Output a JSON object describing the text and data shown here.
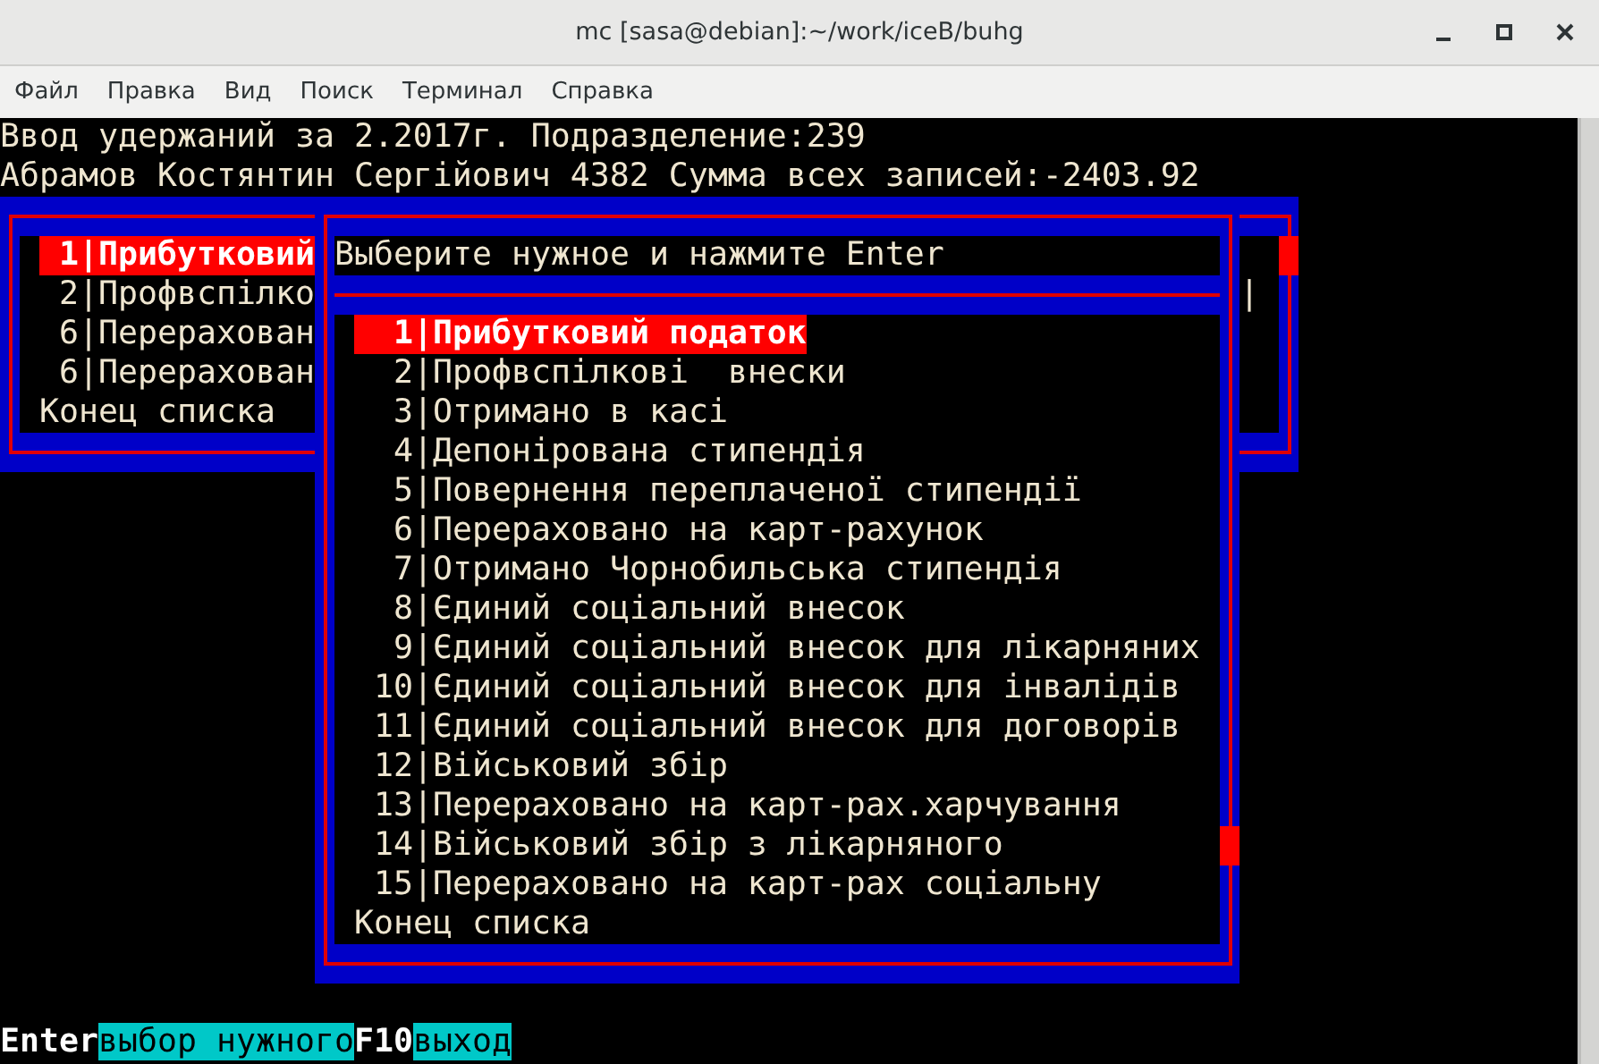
{
  "window": {
    "title": "mc [sasa@debian]:~/work/iceB/buhg"
  },
  "menu": [
    "Файл",
    "Правка",
    "Вид",
    "Поиск",
    "Терминал",
    "Справка"
  ],
  "header_lines": [
    "Ввод удержаний за 2.2017г. Подразделение:239",
    "Абрамов Костянтин Сергійович 4382 Сумма всех записей:-2403.92"
  ],
  "back_list": {
    "separator": "|",
    "column_mark": "|",
    "end_text": "Конец списка",
    "items": [
      {
        "number": "1",
        "label": "Прибутковий",
        "selected": true
      },
      {
        "number": "2",
        "label": "Профвспілко",
        "selected": false
      },
      {
        "number": "6",
        "label": "Перерахован",
        "selected": false
      },
      {
        "number": "6",
        "label": "Перерахован",
        "selected": false
      }
    ]
  },
  "dialog": {
    "prompt": "Выберите нужное и нажмите Enter",
    "separator": "|",
    "end_text": "Конец списка",
    "items": [
      {
        "number": "1",
        "label": "Прибутковий податок",
        "selected": true
      },
      {
        "number": "2",
        "label": "Профвспілкові  внески",
        "selected": false
      },
      {
        "number": "3",
        "label": "Отримано в касі",
        "selected": false
      },
      {
        "number": "4",
        "label": "Депонірована стипендія",
        "selected": false
      },
      {
        "number": "5",
        "label": "Повернення переплаченої стипендії",
        "selected": false
      },
      {
        "number": "6",
        "label": "Перераховано на карт-рахунок",
        "selected": false
      },
      {
        "number": "7",
        "label": "Отримано Чорнобильська стипендія",
        "selected": false
      },
      {
        "number": "8",
        "label": "Єдиний соціальний внесок",
        "selected": false
      },
      {
        "number": "9",
        "label": "Єдиний соціальний внесок для лікарняних",
        "selected": false
      },
      {
        "number": "10",
        "label": "Єдиний соціальний внесок для інвалідів",
        "selected": false
      },
      {
        "number": "11",
        "label": "Єдиний соціальний внесок для договорів",
        "selected": false
      },
      {
        "number": "12",
        "label": "Військовий збір",
        "selected": false
      },
      {
        "number": "13",
        "label": "Перераховано на карт-рах.харчування",
        "selected": false
      },
      {
        "number": "14",
        "label": "Військовий збір з лікарняного",
        "selected": false
      },
      {
        "number": "15",
        "label": "Перераховано на карт-рах соціальну",
        "selected": false
      }
    ]
  },
  "status_bar": [
    {
      "kind": "key",
      "text": "Enter"
    },
    {
      "kind": "action",
      "text": "выбор нужного"
    },
    {
      "kind": "key",
      "text": "F10"
    },
    {
      "kind": "action",
      "text": "выход"
    }
  ]
}
